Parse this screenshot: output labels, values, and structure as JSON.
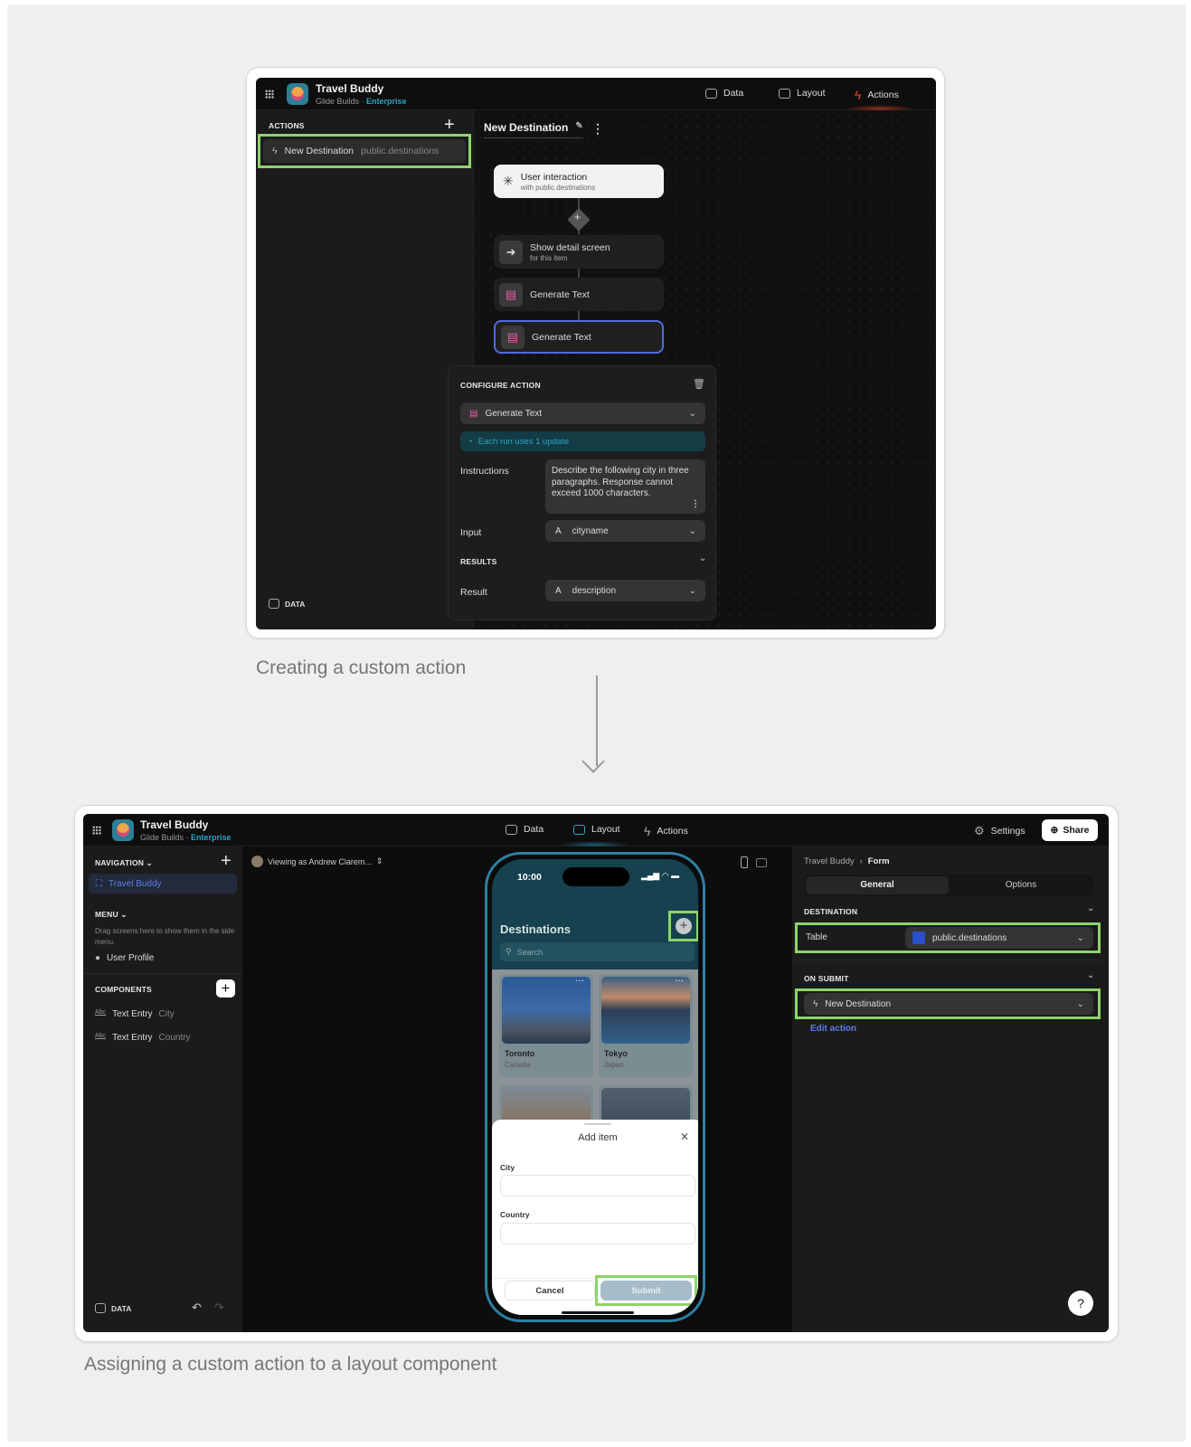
{
  "top": {
    "app": {
      "title": "Travel Buddy",
      "subtitle": "Glide Builds",
      "tier": "Enterprise"
    },
    "nav": [
      {
        "label": "Data",
        "icon": "table-icon"
      },
      {
        "label": "Layout",
        "icon": "layout-icon"
      },
      {
        "label": "Actions",
        "icon": "bolt-icon",
        "active": true
      }
    ],
    "sidebar": {
      "heading": "ACTIONS",
      "items": [
        {
          "label": "New Destination",
          "table": "public.destinations"
        }
      ],
      "footer": "DATA"
    },
    "editor": {
      "title": "New Destination",
      "trigger": {
        "title": "User interaction",
        "subtitle": "with public.destinations"
      },
      "steps": [
        {
          "title": "Show detail screen",
          "subtitle": "for this item"
        },
        {
          "title": "Generate Text",
          "subtitle": ""
        },
        {
          "title": "Generate Text",
          "subtitle": "",
          "selected": true
        }
      ]
    },
    "configure": {
      "heading": "CONFIGURE ACTION",
      "action_type": "Generate Text",
      "notice": "Each run uses 1 update",
      "instructions_label": "Instructions",
      "instructions_value": "Describe the following city in three paragraphs. Response cannot exceed 1000 characters.",
      "input_label": "Input",
      "input_value": "cityname",
      "results_heading": "RESULTS",
      "result_label": "Result",
      "result_value": "description"
    },
    "caption": "Creating a custom action"
  },
  "bottom": {
    "app": {
      "title": "Travel Buddy",
      "subtitle": "Glide Builds",
      "tier": "Enterprise"
    },
    "nav": [
      {
        "label": "Data"
      },
      {
        "label": "Layout",
        "active": true
      },
      {
        "label": "Actions"
      }
    ],
    "settings_label": "Settings",
    "share_label": "Share",
    "sidebar": {
      "navigation_heading": "NAVIGATION",
      "nav_items": [
        "Travel Buddy"
      ],
      "menu_heading": "MENU",
      "menu_hint": "Drag screens here to show them in the side menu.",
      "menu_items": [
        "User Profile"
      ],
      "components_heading": "COMPONENTS",
      "components": [
        {
          "type": "Text Entry",
          "name": "City"
        },
        {
          "type": "Text Entry",
          "name": "Country"
        }
      ],
      "footer": "DATA"
    },
    "viewing_as": "Viewing as Andrew Clarem...",
    "phone": {
      "time": "10:00",
      "title": "Destinations",
      "search_placeholder": "Search",
      "cards": [
        {
          "city": "Toronto",
          "country": "Canada"
        },
        {
          "city": "Tokyo",
          "country": "Japan"
        }
      ],
      "sheet": {
        "title": "Add item",
        "fields": [
          {
            "label": "City",
            "value": ""
          },
          {
            "label": "Country",
            "value": ""
          }
        ],
        "cancel_label": "Cancel",
        "submit_label": "Submit"
      }
    },
    "inspector": {
      "breadcrumb": [
        "Travel Buddy",
        "Form"
      ],
      "tabs": [
        {
          "label": "General",
          "active": true
        },
        {
          "label": "Options"
        }
      ],
      "destination_heading": "DESTINATION",
      "table_label": "Table",
      "table_value": "public.destinations",
      "on_submit_heading": "ON SUBMIT",
      "on_submit_value": "New Destination",
      "edit_action_label": "Edit action"
    },
    "help_label": "?",
    "caption": "Assigning a custom action to a layout component"
  },
  "colors": {
    "highlight": "#8ed36b",
    "accent_blue": "#2aa6c7",
    "actions_red": "#e0452b",
    "selected_node": "#4f6be0"
  }
}
